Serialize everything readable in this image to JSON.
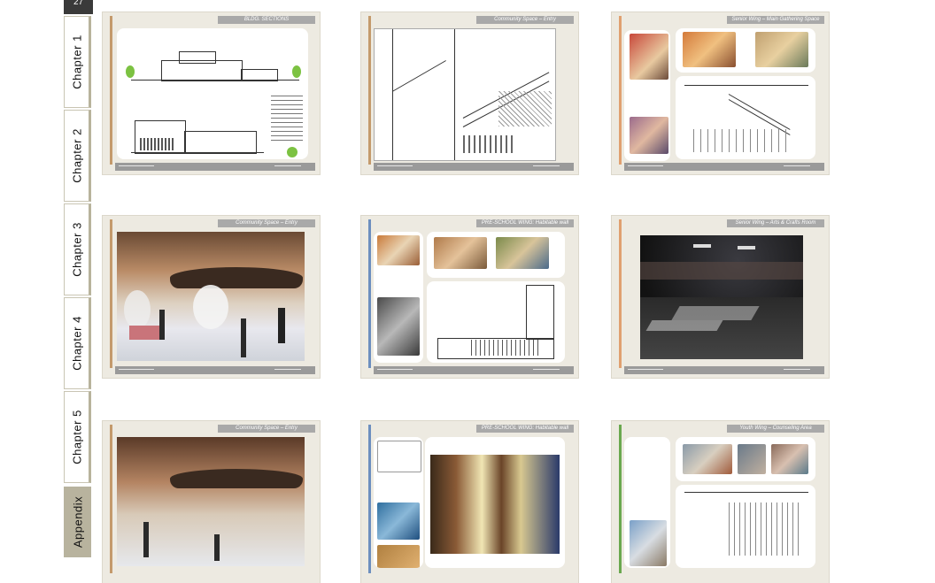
{
  "page_badge": "27",
  "tabs": [
    {
      "label": "Chapter 1"
    },
    {
      "label": "Chapter 2"
    },
    {
      "label": "Chapter 3"
    },
    {
      "label": "Chapter 4"
    },
    {
      "label": "Chapter 5"
    },
    {
      "label": "Appendix"
    }
  ],
  "thumbnails": [
    {
      "title": "BLDG. SECTIONS",
      "accent": "#c49a6c"
    },
    {
      "title": "Community Space – Entry",
      "accent": "#c49a6c"
    },
    {
      "title": "Senior Wing – Main Gathering Space",
      "accent": "#e0a070"
    },
    {
      "title": "Community Space – Entry",
      "accent": "#c49a6c"
    },
    {
      "title": "PRE-SCHOOL WING: Habitable wall",
      "accent": "#6d8fbf"
    },
    {
      "title": "Senior Wing – Arts & Crafts Room",
      "accent": "#e0a070"
    },
    {
      "title": "Community Space – Entry",
      "accent": "#c49a6c"
    },
    {
      "title": "PRE-SCHOOL WING: Habitable wall",
      "accent": "#6d8fbf"
    },
    {
      "title": "Youth Wing – Counseling Area",
      "accent": "#6aa84f"
    }
  ]
}
